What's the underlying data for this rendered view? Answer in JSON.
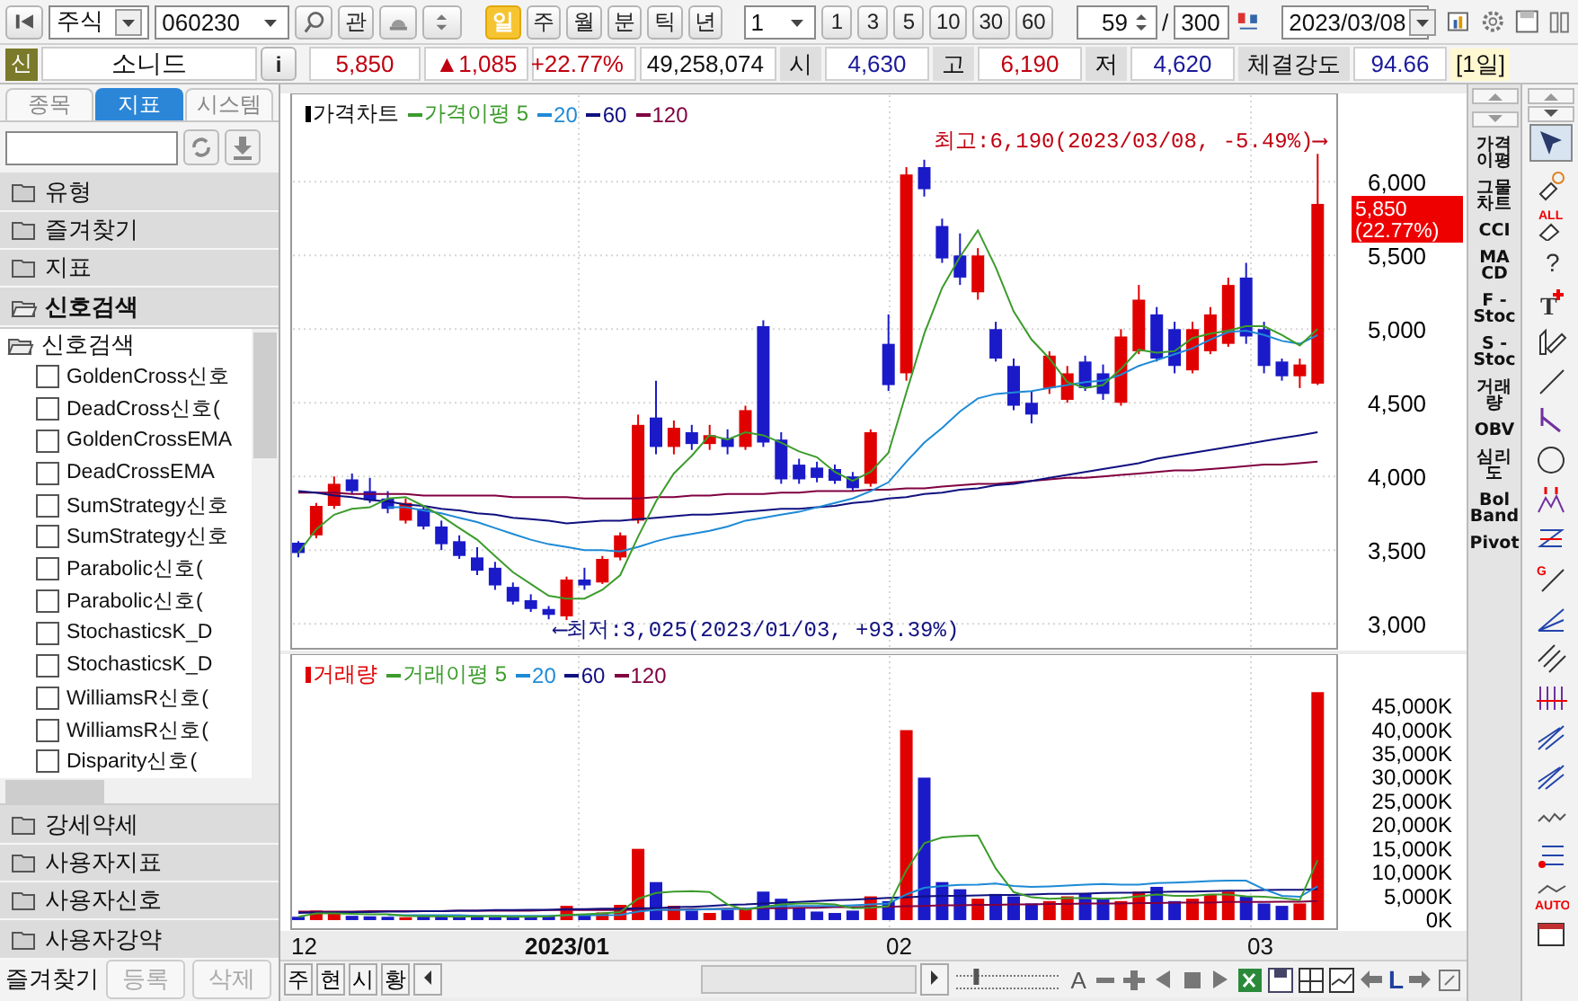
{
  "toolbar": {
    "market": "주식",
    "code": "060230",
    "relation_button": "관",
    "periods": [
      {
        "label": "일",
        "selected": true
      },
      {
        "label": "주",
        "selected": false
      },
      {
        "label": "월",
        "selected": false
      },
      {
        "label": "분",
        "selected": false
      },
      {
        "label": "틱",
        "selected": false
      },
      {
        "label": "년",
        "selected": false
      }
    ],
    "interval": "1",
    "interval_buttons": [
      "1",
      "3",
      "5",
      "10",
      "30",
      "60"
    ],
    "count": "59",
    "separator": "/",
    "total": "300",
    "date": "2023/03/08"
  },
  "quote": {
    "badge": "신",
    "name": "소니드",
    "info_button": "i",
    "price": "5,850",
    "change": "▲1,085",
    "rate": "+22.77%",
    "volume": "49,258,074",
    "fields": [
      {
        "label": "시",
        "value": "4,630",
        "kind": "down"
      },
      {
        "label": "고",
        "value": "6,190",
        "kind": "up"
      },
      {
        "label": "저",
        "value": "4,620",
        "kind": "down"
      },
      {
        "label": "체결강도",
        "value": "94.66",
        "kind": "down"
      }
    ],
    "period": "[1일]"
  },
  "sidebar": {
    "tabs": [
      {
        "label": "종목",
        "selected": false
      },
      {
        "label": "지표",
        "selected": true
      },
      {
        "label": "시스템",
        "selected": false
      }
    ],
    "folders_top": [
      {
        "label": "유형",
        "expanded": false
      },
      {
        "label": "즐겨찾기",
        "expanded": false
      },
      {
        "label": "지표",
        "expanded": false
      },
      {
        "label": "신호검색",
        "expanded": true
      }
    ],
    "tree": {
      "label": "신호검색",
      "children": [
        {
          "label": "GoldenCross신호",
          "checked": false
        },
        {
          "label": "DeadCross신호(",
          "checked": false
        },
        {
          "label": "GoldenCrossEMA",
          "checked": false
        },
        {
          "label": "DeadCrossEMA",
          "checked": false
        },
        {
          "label": "SumStrategy신호",
          "checked": false
        },
        {
          "label": "SumStrategy신호",
          "checked": false
        },
        {
          "label": "Parabolic신호(",
          "checked": false
        },
        {
          "label": "Parabolic신호(",
          "checked": false
        },
        {
          "label": "StochasticsK_D",
          "checked": false
        },
        {
          "label": "StochasticsK_D",
          "checked": false
        },
        {
          "label": "WilliamsR신호(",
          "checked": false
        },
        {
          "label": "WilliamsR신호(",
          "checked": false
        },
        {
          "label": "Disparity신호(",
          "checked": false
        }
      ]
    },
    "folders_bottom": [
      {
        "label": "강세약세",
        "expanded": false
      },
      {
        "label": "사용자지표",
        "expanded": false
      },
      {
        "label": "사용자신호",
        "expanded": false
      },
      {
        "label": "사용자강약",
        "expanded": false
      }
    ],
    "footer": {
      "label": "즐겨찾기",
      "buttons": [
        {
          "label": "등록",
          "disabled": true
        },
        {
          "label": "삭제",
          "disabled": true
        }
      ]
    }
  },
  "price_chart": {
    "candles_label": "가격차트",
    "chart_data": {
      "type": "candlestick",
      "categories": [
        null,
        null,
        null,
        null,
        null,
        null,
        null,
        null,
        null,
        null,
        null,
        null,
        null,
        null,
        null,
        null,
        null,
        null,
        null,
        null,
        null,
        null,
        null,
        null,
        null,
        null,
        null,
        null,
        null,
        null,
        null,
        null,
        null,
        null,
        null,
        null,
        null,
        null,
        null,
        null,
        null,
        null,
        null,
        null,
        null,
        null,
        null,
        null,
        null,
        null,
        null,
        null,
        null,
        null,
        null,
        null,
        null,
        null
      ],
      "ylim": [
        2830,
        6600
      ],
      "grid": true,
      "legend": "upper left",
      "yticks": [
        {
          "value": 6000,
          "label": "6,000"
        },
        {
          "value": 5500,
          "label": "5,500"
        },
        {
          "value": 5000,
          "label": "5,000"
        },
        {
          "value": 4500,
          "label": "4,500"
        },
        {
          "value": 4000,
          "label": "4,000"
        },
        {
          "value": 3500,
          "label": "3,500"
        },
        {
          "value": 3000,
          "label": "3,000"
        }
      ],
      "ohlc": [
        [
          3550,
          3560,
          3450,
          3480
        ],
        [
          3600,
          3820,
          3580,
          3800
        ],
        [
          3800,
          4000,
          3780,
          3950
        ],
        [
          3980,
          4020,
          3880,
          3900
        ],
        [
          3900,
          3990,
          3820,
          3840
        ],
        [
          3850,
          3900,
          3750,
          3780
        ],
        [
          3700,
          3850,
          3680,
          3820
        ],
        [
          3780,
          3800,
          3640,
          3660
        ],
        [
          3660,
          3700,
          3500,
          3540
        ],
        [
          3560,
          3600,
          3440,
          3460
        ],
        [
          3450,
          3520,
          3330,
          3360
        ],
        [
          3380,
          3420,
          3230,
          3260
        ],
        [
          3250,
          3280,
          3130,
          3150
        ],
        [
          3160,
          3200,
          3080,
          3100
        ],
        [
          3100,
          3120,
          3030,
          3060
        ],
        [
          3050,
          3320,
          3025,
          3300
        ],
        [
          3300,
          3380,
          3230,
          3260
        ],
        [
          3280,
          3460,
          3270,
          3440
        ],
        [
          3450,
          3620,
          3430,
          3600
        ],
        [
          3700,
          4420,
          3680,
          4350
        ],
        [
          4400,
          4650,
          4150,
          4200
        ],
        [
          4200,
          4380,
          4150,
          4330
        ],
        [
          4300,
          4350,
          4180,
          4220
        ],
        [
          4220,
          4350,
          4180,
          4280
        ],
        [
          4260,
          4320,
          4150,
          4200
        ],
        [
          4200,
          4480,
          4180,
          4450
        ],
        [
          5020,
          5060,
          4200,
          4230
        ],
        [
          4250,
          4300,
          3950,
          3980
        ],
        [
          4080,
          4120,
          3950,
          3980
        ],
        [
          4060,
          4100,
          3960,
          3990
        ],
        [
          4050,
          4080,
          3950,
          3970
        ],
        [
          4000,
          4030,
          3900,
          3920
        ],
        [
          3950,
          4320,
          3930,
          4300
        ],
        [
          4900,
          5100,
          4580,
          4620
        ],
        [
          4700,
          6100,
          4650,
          6050
        ],
        [
          6100,
          6150,
          5900,
          5950
        ],
        [
          5700,
          5750,
          5450,
          5480
        ],
        [
          5500,
          5650,
          5300,
          5350
        ],
        [
          5250,
          5550,
          5200,
          5500
        ],
        [
          5000,
          5050,
          4780,
          4800
        ],
        [
          4750,
          4800,
          4450,
          4480
        ],
        [
          4500,
          4580,
          4360,
          4420
        ],
        [
          4600,
          4850,
          4560,
          4820
        ],
        [
          4520,
          4750,
          4500,
          4700
        ],
        [
          4780,
          4820,
          4580,
          4600
        ],
        [
          4700,
          4760,
          4520,
          4560
        ],
        [
          4500,
          5000,
          4480,
          4950
        ],
        [
          4850,
          5300,
          4830,
          5200
        ],
        [
          5100,
          5150,
          4780,
          4800
        ],
        [
          5000,
          5050,
          4700,
          4750
        ],
        [
          4720,
          5050,
          4700,
          5000
        ],
        [
          4850,
          5150,
          4830,
          5100
        ],
        [
          4900,
          5350,
          4880,
          5300
        ],
        [
          5350,
          5450,
          4900,
          4950
        ],
        [
          5000,
          5050,
          4700,
          4750
        ],
        [
          4780,
          4800,
          4650,
          4680
        ],
        [
          4680,
          4800,
          4600,
          4760
        ],
        [
          4630,
          6190,
          4620,
          5850
        ]
      ],
      "series": [
        {
          "name": "가격이평 5",
          "type": "line",
          "color": "#3c9c2c",
          "values": [
            3480,
            3640,
            3740,
            3780,
            3790,
            3850,
            3860,
            3800,
            3730,
            3650,
            3570,
            3460,
            3350,
            3270,
            3190,
            3170,
            3170,
            3230,
            3330,
            3590,
            3830,
            4020,
            4140,
            4280,
            4250,
            4300,
            4280,
            4230,
            4170,
            4130,
            4030,
            3970,
            4030,
            4160,
            4570,
            4970,
            5280,
            5490,
            5670,
            5420,
            5120,
            4930,
            4800,
            4640,
            4600,
            4620,
            4730,
            4860,
            4840,
            4850,
            4940,
            4970,
            4990,
            5020,
            5020,
            4960,
            4890,
            5000
          ]
        },
        {
          "name": "20",
          "type": "line",
          "color": "#1e8ad6",
          "values": [
            null,
            null,
            null,
            null,
            null,
            3790,
            3790,
            3770,
            3750,
            3720,
            3690,
            3650,
            3610,
            3570,
            3540,
            3520,
            3500,
            3500,
            3490,
            3520,
            3560,
            3590,
            3610,
            3630,
            3660,
            3700,
            3720,
            3740,
            3760,
            3790,
            3820,
            3850,
            3900,
            3960,
            4100,
            4230,
            4330,
            4440,
            4530,
            4560,
            4570,
            4580,
            4600,
            4620,
            4640,
            4650,
            4690,
            4750,
            4790,
            4830,
            4870,
            4930,
            4980,
            4990,
            4960,
            4920,
            4900,
            4960
          ]
        },
        {
          "name": "60",
          "type": "line",
          "color": "#101080",
          "values": [
            3900,
            3890,
            3870,
            3860,
            3840,
            3830,
            3810,
            3800,
            3780,
            3770,
            3750,
            3740,
            3720,
            3710,
            3700,
            3680,
            3690,
            3700,
            3700,
            3710,
            3720,
            3730,
            3740,
            3740,
            3750,
            3760,
            3770,
            3780,
            3780,
            3790,
            3800,
            3820,
            3830,
            3850,
            3860,
            3880,
            3890,
            3910,
            3920,
            3940,
            3950,
            3970,
            3990,
            4010,
            4030,
            4050,
            4070,
            4090,
            4120,
            4140,
            4160,
            4180,
            4200,
            4220,
            4240,
            4260,
            4280,
            4300
          ]
        },
        {
          "name": "120",
          "type": "line",
          "color": "#800040",
          "values": [
            3890,
            3890,
            3890,
            3880,
            3880,
            3880,
            3880,
            3870,
            3870,
            3870,
            3870,
            3870,
            3860,
            3860,
            3860,
            3860,
            3850,
            3850,
            3850,
            3850,
            3860,
            3860,
            3870,
            3870,
            3880,
            3880,
            3880,
            3890,
            3890,
            3900,
            3900,
            3900,
            3910,
            3910,
            3920,
            3920,
            3930,
            3940,
            3950,
            3950,
            3960,
            3970,
            3980,
            3990,
            3990,
            4000,
            4010,
            4020,
            4030,
            4040,
            4040,
            4050,
            4060,
            4070,
            4080,
            4080,
            4090,
            4100
          ]
        }
      ]
    },
    "high_note": "최고:6,190(2023/03/08, -5.49%)⟶",
    "low_note": "⟵최저:3,025(2023/01/03, +93.39%)",
    "last_price": "5,850",
    "last_rate": "(22.77%)"
  },
  "volume_chart": {
    "chart_data": {
      "type": "bar",
      "categories": [
        null,
        null,
        null,
        null,
        null,
        null,
        null,
        null,
        null,
        null,
        null,
        null,
        null,
        null,
        null,
        null,
        null,
        null,
        null,
        null,
        null,
        null,
        null,
        null,
        null,
        null,
        null,
        null,
        null,
        null,
        null,
        null,
        null,
        null,
        null,
        null,
        null,
        null,
        null,
        null,
        null,
        null,
        null,
        null,
        null,
        null,
        null,
        null,
        null,
        null,
        null,
        null,
        null,
        null,
        null,
        null,
        null,
        null
      ],
      "ylim": [
        -1900,
        56000
      ],
      "grid": true,
      "legend": "upper left",
      "yticks": [
        {
          "value": 45000,
          "label": "45,000K"
        },
        {
          "value": 40000,
          "label": "40,000K"
        },
        {
          "value": 35000,
          "label": "35,000K"
        },
        {
          "value": 30000,
          "label": "30,000K"
        },
        {
          "value": 25000,
          "label": "25,000K"
        },
        {
          "value": 20000,
          "label": "20,000K"
        },
        {
          "value": 15000,
          "label": "15,000K"
        },
        {
          "value": 10000,
          "label": "10,000K"
        },
        {
          "value": 5000,
          "label": "5,000K"
        },
        {
          "value": 0,
          "label": "0K"
        }
      ],
      "series": [
        {
          "name": "거래량",
          "type": "bar",
          "color": "#e00000",
          "values": [
            null,
            2000,
            1500,
            null,
            null,
            null,
            600,
            null,
            null,
            null,
            null,
            null,
            null,
            null,
            null,
            3000,
            null,
            1600,
            3200,
            15000,
            null,
            3000,
            null,
            1500,
            null,
            2500,
            null,
            null,
            null,
            null,
            null,
            null,
            5000,
            null,
            40000,
            null,
            null,
            null,
            4500,
            null,
            null,
            null,
            4000,
            5000,
            null,
            null,
            4000,
            6000,
            null,
            null,
            4500,
            5500,
            6000,
            null,
            null,
            null,
            3500,
            48000
          ]
        },
        {
          "type": "bar",
          "color": "#1a1ac8",
          "values": [
            700,
            null,
            null,
            900,
            800,
            700,
            null,
            800,
            900,
            700,
            800,
            600,
            700,
            900,
            800,
            null,
            1200,
            null,
            null,
            null,
            8000,
            null,
            2000,
            null,
            2200,
            null,
            6000,
            4500,
            2500,
            1800,
            1500,
            2000,
            null,
            4000,
            null,
            30000,
            8000,
            6500,
            null,
            5500,
            5000,
            3500,
            null,
            null,
            5500,
            4500,
            null,
            null,
            7000,
            4000,
            null,
            null,
            null,
            5000,
            3500,
            3000,
            null,
            null
          ]
        },
        {
          "name": "거래이평 5",
          "type": "line",
          "color": "#3c9c2c",
          "values": [
            700,
            1400,
            1400,
            1300,
            1200,
            1200,
            900,
            800,
            800,
            700,
            800,
            800,
            700,
            700,
            800,
            1100,
            1200,
            1400,
            1700,
            4500,
            5700,
            6000,
            6100,
            5900,
            3300,
            2200,
            2800,
            3300,
            3500,
            3500,
            3300,
            2500,
            2600,
            2900,
            10500,
            16200,
            17400,
            17700,
            17800,
            10900,
            5900,
            4800,
            4500,
            4600,
            4600,
            4500,
            4600,
            5000,
            5400,
            5100,
            5100,
            5400,
            5400,
            5000,
            4900,
            4600,
            4200,
            12600
          ]
        },
        {
          "name": "20",
          "type": "line",
          "color": "#1e8ad6",
          "values": [
            null,
            null,
            null,
            null,
            null,
            1100,
            1000,
            1000,
            1000,
            1000,
            900,
            900,
            900,
            900,
            900,
            1000,
            1000,
            1000,
            1100,
            1800,
            2200,
            2200,
            2200,
            2300,
            2300,
            2400,
            2700,
            2900,
            3000,
            3000,
            3000,
            3100,
            3300,
            3500,
            5400,
            6800,
            7200,
            7400,
            7500,
            7700,
            7200,
            7000,
            7100,
            7300,
            7500,
            7600,
            7500,
            7500,
            7800,
            7900,
            8000,
            8200,
            8300,
            8300,
            6500,
            5100,
            4900,
            7100
          ]
        },
        {
          "name": "60",
          "type": "line",
          "color": "#101080",
          "values": [
            1500,
            1600,
            1600,
            1700,
            1700,
            1800,
            1800,
            1900,
            1900,
            2000,
            2000,
            2100,
            2100,
            2200,
            2200,
            2300,
            2300,
            2400,
            2400,
            2500,
            2500,
            2700,
            2800,
            3000,
            3200,
            3300,
            3500,
            3700,
            3800,
            4000,
            4200,
            4300,
            4500,
            4700,
            4800,
            5000,
            5100,
            5100,
            5200,
            5300,
            5300,
            5400,
            5500,
            5500,
            5600,
            5700,
            5800,
            5800,
            5900,
            6000,
            6000,
            6100,
            6200,
            6200,
            6300,
            6400,
            6400,
            6500
          ]
        },
        {
          "name": "120",
          "type": "line",
          "color": "#800040",
          "values": [
            1800,
            1800,
            1800,
            1800,
            1900,
            1900,
            1900,
            1900,
            1900,
            2000,
            2000,
            2000,
            2000,
            2000,
            2100,
            2100,
            2100,
            2100,
            2100,
            2200,
            2200,
            2200,
            2300,
            2300,
            2400,
            2400,
            2500,
            2500,
            2600,
            2600,
            2700,
            2700,
            2800,
            2800,
            2900,
            3000,
            3100,
            3100,
            3200,
            3200,
            3300,
            3300,
            3400,
            3400,
            3500,
            3500,
            3500,
            3600,
            3600,
            3700,
            3700,
            3700,
            3800,
            3800,
            3800,
            3900,
            3900,
            4000
          ]
        }
      ]
    }
  },
  "x_labels": [
    {
      "label": "12",
      "bold": false
    },
    {
      "label": "2023/01",
      "bold": true
    },
    {
      "label": "02",
      "bold": false
    },
    {
      "label": "03",
      "bold": false
    }
  ],
  "bottom_bar": {
    "buttons": [
      "주",
      "현",
      "시",
      "황"
    ],
    "zoom": {
      "level": 0.2
    },
    "font_button": "A",
    "line_button": "L"
  },
  "indicators": [
    "가격\n이평",
    "그물\n차트",
    "CCI",
    "MA\nCD",
    "F -\nStoc",
    "S -\nStoc",
    "거래\n량",
    "OBV",
    "심리\n도",
    "Bol\nBand",
    "Pivot"
  ],
  "tools": [
    {
      "kind": "pointer",
      "selected": true
    },
    {
      "kind": "magic",
      "selected": false
    },
    {
      "kind": "erase_all",
      "text": "ALL",
      "selected": false
    },
    {
      "kind": "help",
      "text": "?",
      "selected": false
    },
    {
      "kind": "text",
      "text": "T",
      "selected": false
    },
    {
      "kind": "pen",
      "selected": false
    },
    {
      "kind": "line",
      "selected": false
    },
    {
      "kind": "angle",
      "selected": false
    },
    {
      "kind": "circle",
      "selected": false
    },
    {
      "kind": "peaks",
      "selected": false
    },
    {
      "kind": "zigzag",
      "selected": false
    },
    {
      "kind": "gann",
      "text": "G",
      "selected": false
    },
    {
      "kind": "fan",
      "selected": false
    },
    {
      "kind": "channel",
      "selected": false
    },
    {
      "kind": "cycle",
      "selected": false
    },
    {
      "kind": "speed",
      "selected": false
    },
    {
      "kind": "speed",
      "selected": false
    },
    {
      "kind": "wave",
      "selected": false
    },
    {
      "kind": "levels",
      "selected": false
    },
    {
      "kind": "auto",
      "text": "AUTO",
      "selected": false
    },
    {
      "kind": "window",
      "selected": false
    }
  ]
}
